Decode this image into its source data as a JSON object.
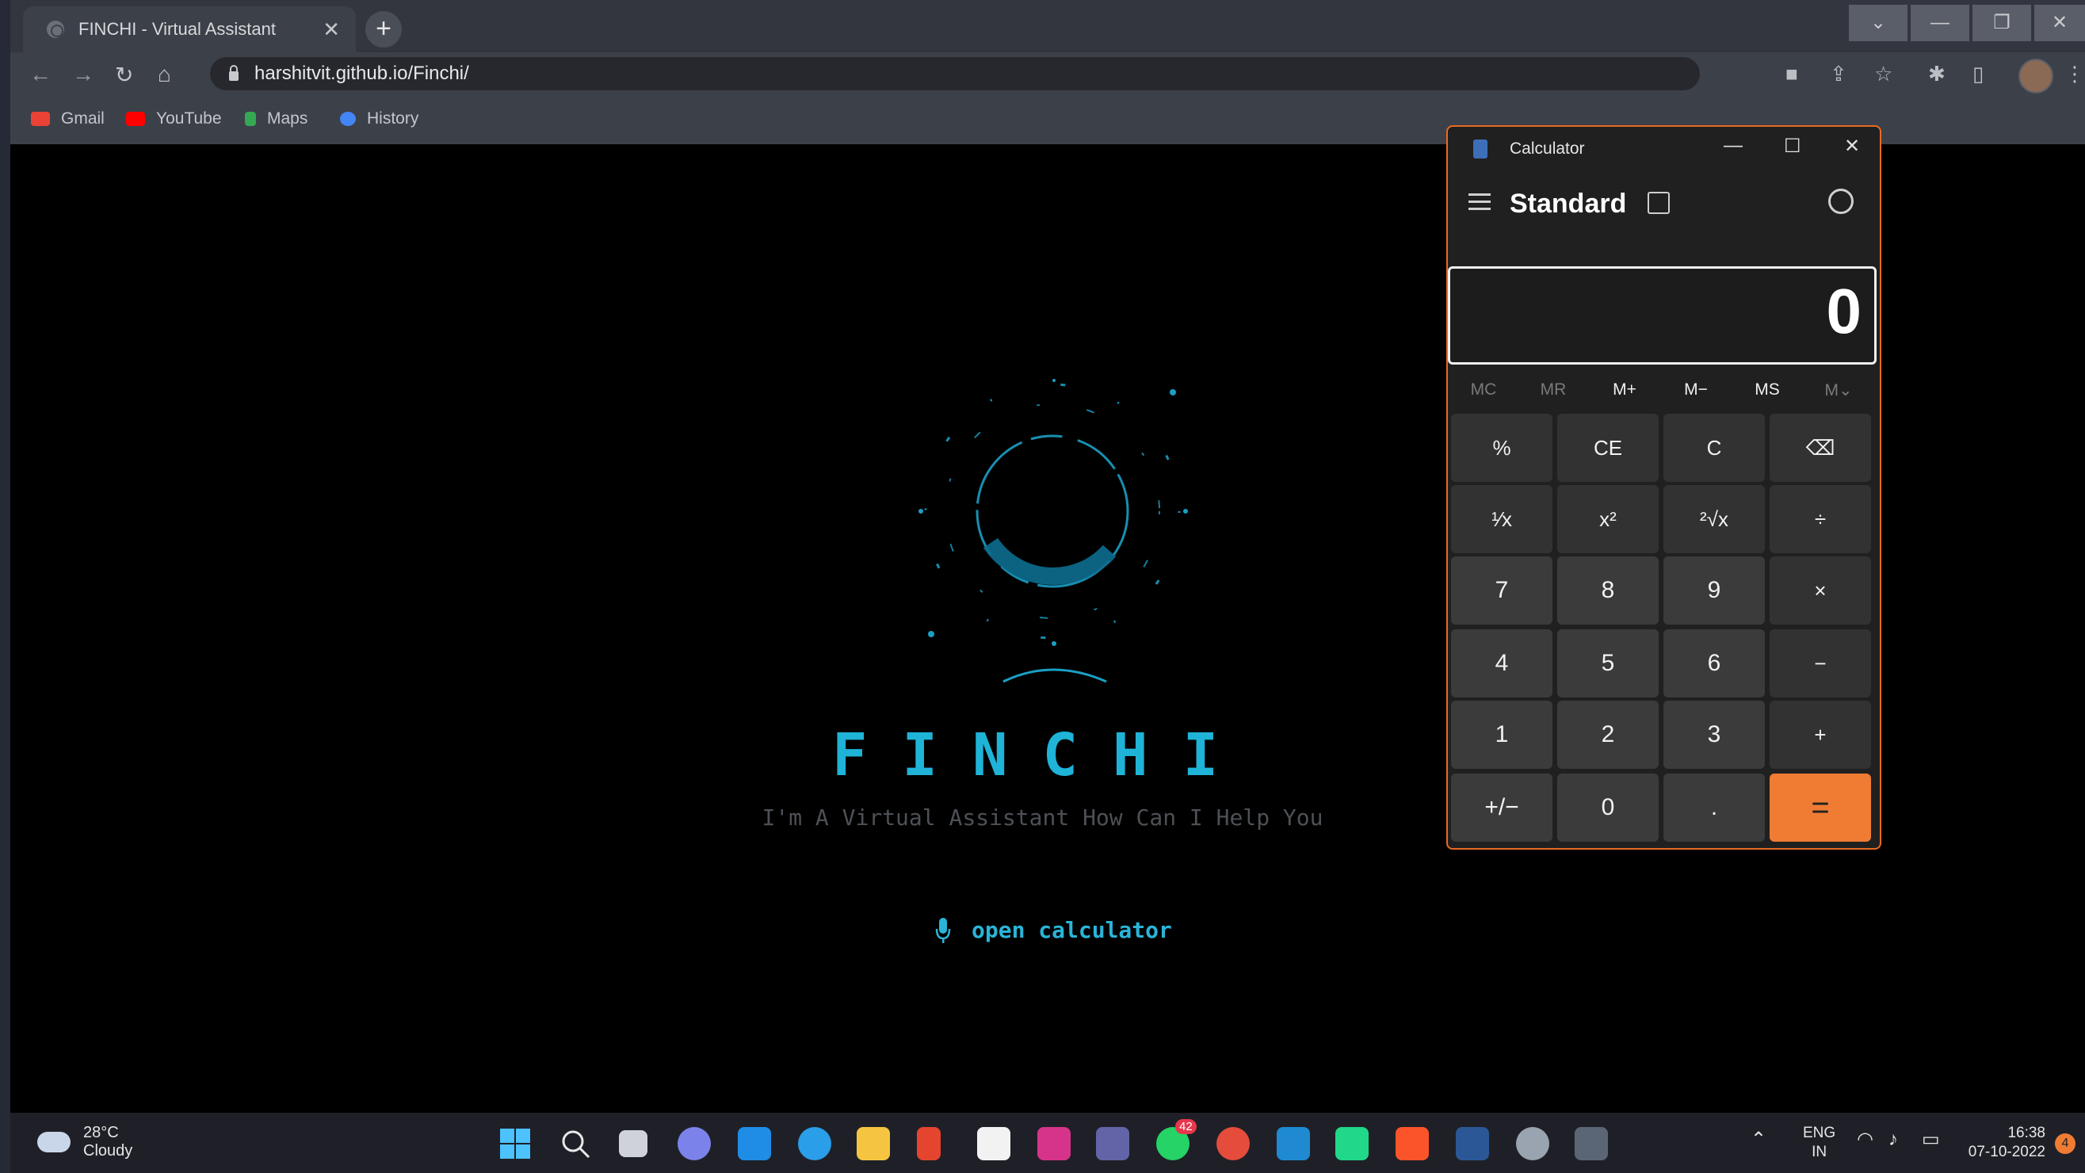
{
  "browser": {
    "tab_title": "FINCHI - Virtual Assistant",
    "new_tab_label": "+",
    "url": "harshitvit.github.io/Finchi/",
    "bookmarks": [
      {
        "label": "Gmail",
        "color": "#ea4335"
      },
      {
        "label": "YouTube",
        "color": "#ff0000"
      },
      {
        "label": "Maps",
        "color": "#34a853"
      },
      {
        "label": "History",
        "color": "#4285f4"
      }
    ]
  },
  "page": {
    "brand": "FINCHI",
    "subtitle": "I'm A Virtual Assistant How Can I Help You",
    "command": "open calculator",
    "accent_color": "#1fb3d8"
  },
  "calculator": {
    "window_title": "Calculator",
    "mode": "Standard",
    "display_value": "0",
    "memory_buttons": [
      "MC",
      "MR",
      "M+",
      "M−",
      "MS",
      "M⌄"
    ],
    "keys": [
      [
        "%",
        "CE",
        "C",
        "⌫"
      ],
      [
        "¹⁄x",
        "x²",
        "²√x",
        "÷"
      ],
      [
        "7",
        "8",
        "9",
        "×"
      ],
      [
        "4",
        "5",
        "6",
        "−"
      ],
      [
        "1",
        "2",
        "3",
        "+"
      ],
      [
        "+/−",
        "0",
        ".",
        "="
      ]
    ],
    "equals_color": "#f07c34"
  },
  "taskbar": {
    "temperature": "28°C",
    "weather": "Cloudy",
    "whatsapp_badge": "42",
    "language_top": "ENG",
    "language_bottom": "IN",
    "time": "16:38",
    "date": "07-10-2022",
    "apps": [
      "windows-start",
      "search",
      "task-view",
      "chat",
      "mail",
      "edge",
      "file-explorer",
      "office",
      "store",
      "instagram",
      "teams",
      "whatsapp",
      "chrome",
      "vscode",
      "pycharm",
      "brave",
      "word",
      "settings",
      "calculator"
    ]
  }
}
